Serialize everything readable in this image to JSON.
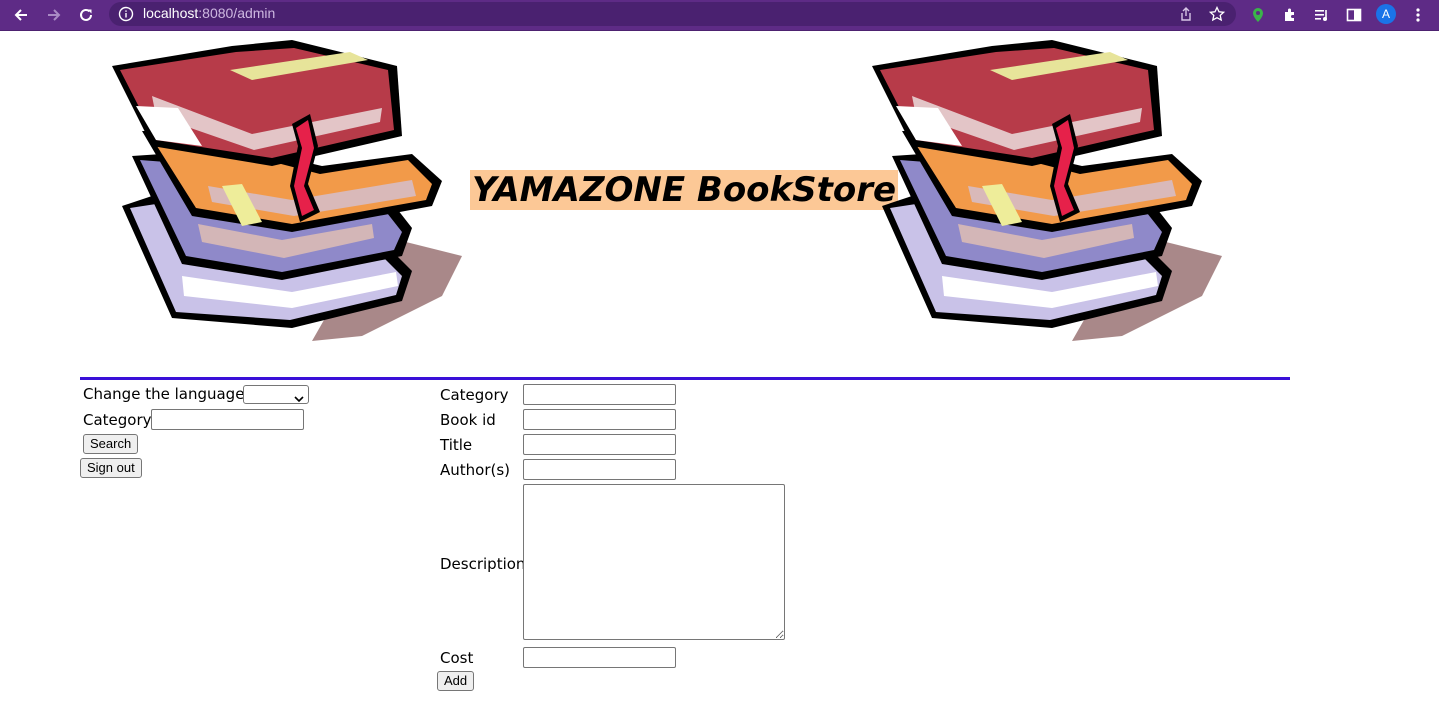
{
  "browser": {
    "url_host": "localhost",
    "url_rest": ":8080/admin",
    "avatar_letter": "A",
    "frame_color": "#5e2b86"
  },
  "header": {
    "title": "YAMAZONE BookStore",
    "title_bg": "#fcc896",
    "rule_color": "#3a10d8",
    "image_icon": "stack-of-books"
  },
  "sidebar": {
    "language_label": "Change the language:",
    "language_value": "",
    "category_label": "Category",
    "category_value": "",
    "search_label": "Search",
    "signout_label": "Sign out"
  },
  "add_form": {
    "category_label": "Category",
    "bookid_label": "Book id",
    "title_label": "Title",
    "authors_label": "Author(s)",
    "description_label": "Description",
    "cost_label": "Cost",
    "add_label": "Add",
    "category_value": "",
    "bookid_value": "",
    "title_value": "",
    "authors_value": "",
    "description_value": "",
    "cost_value": ""
  }
}
